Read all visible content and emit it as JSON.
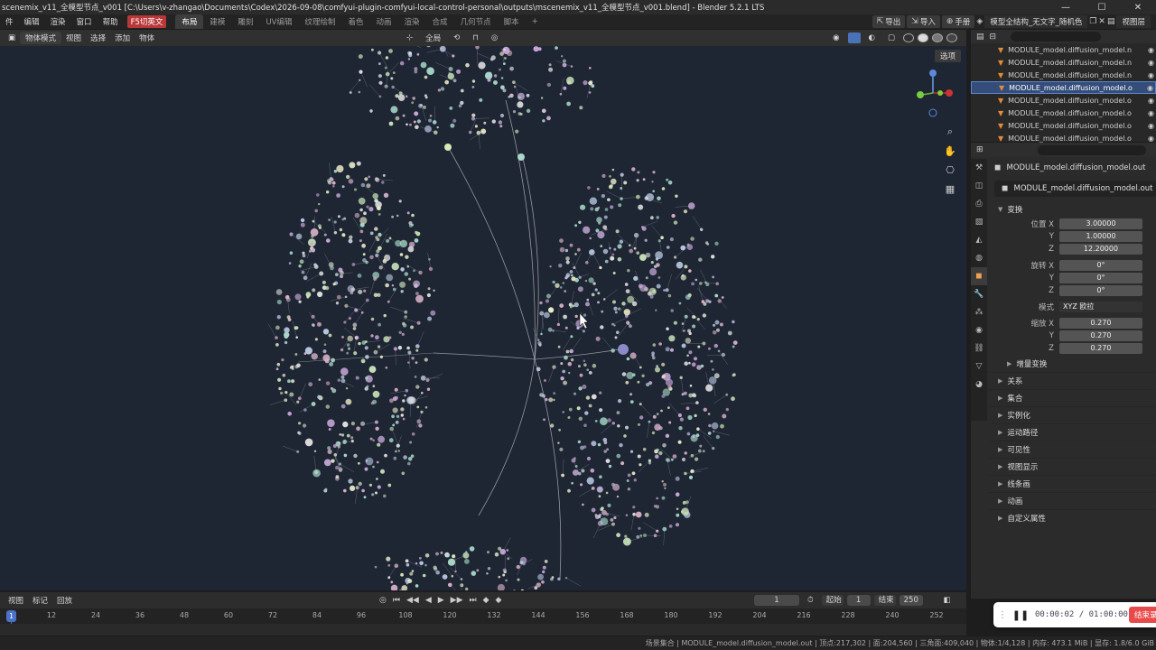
{
  "window": {
    "title": "scenemix_v11_全模型节点_v001 [C:\\Users\\v-zhangao\\Documents\\Codex\\2026-09-08\\comfyui-plugin-comfyui-local-control-personal\\outputs\\mscenemix_v11_全模型节点_v001.blend] - Blender 5.2.1 LTS",
    "minimize": "—",
    "maximize": "☐",
    "close": "✕"
  },
  "menu": [
    "件",
    "编辑",
    "渲染",
    "窗口",
    "帮助"
  ],
  "menu_highlight": "F5切英文",
  "workspace_tabs": [
    {
      "label": "布局",
      "active": true
    },
    {
      "label": "建模",
      "active": false
    },
    {
      "label": "雕刻",
      "active": false
    },
    {
      "label": "UV编辑",
      "active": false
    },
    {
      "label": "纹理绘制",
      "active": false
    },
    {
      "label": "着色",
      "active": false
    },
    {
      "label": "动画",
      "active": false
    },
    {
      "label": "渲染",
      "active": false
    },
    {
      "label": "合成",
      "active": false
    },
    {
      "label": "几何节点",
      "active": false
    },
    {
      "label": "脚本",
      "active": false
    },
    {
      "label": "+",
      "active": false
    }
  ],
  "top_right": {
    "export_label": "导出",
    "import_label": "导入",
    "manual_label": "手册",
    "scene_label": "模型全结构_无文字_随机色",
    "viewlayer_label": "视图层"
  },
  "viewport_header": {
    "mode": "物体模式",
    "menus": [
      "视图",
      "选择",
      "添加",
      "物体"
    ],
    "orientation": "全局",
    "options_label": "选项"
  },
  "outliner": {
    "search_placeholder": "",
    "rows": [
      {
        "label": "MODULE_model.diffusion_model.n",
        "selected": false
      },
      {
        "label": "MODULE_model.diffusion_model.n",
        "selected": false
      },
      {
        "label": "MODULE_model.diffusion_model.n",
        "selected": false
      },
      {
        "label": "MODULE_model.diffusion_model.o",
        "selected": true
      },
      {
        "label": "MODULE_model.diffusion_model.o",
        "selected": false
      },
      {
        "label": "MODULE_model.diffusion_model.o",
        "selected": false
      },
      {
        "label": "MODULE_model.diffusion_model.o",
        "selected": false
      },
      {
        "label": "MODULE_model.diffusion_model.o",
        "selected": false
      }
    ]
  },
  "properties": {
    "object_name": "MODULE_model.diffusion_model.out",
    "object_field": "MODULE_model.diffusion_model.out",
    "transform_label": "变换",
    "location": {
      "label": "位置",
      "x": "3.00000",
      "y": "1.00000",
      "z": "12.20000"
    },
    "rotation": {
      "label": "旋转",
      "x": "0°",
      "y": "0°",
      "z": "0°"
    },
    "mode_label": "模式",
    "mode_value": "XYZ 欧拉",
    "scale": {
      "label": "缩放",
      "x": "0.270",
      "y": "0.270",
      "z": "0.270"
    },
    "delta_label": "增量变换",
    "axis_x": "X",
    "axis_y": "Y",
    "axis_z": "Z",
    "sections": [
      "关系",
      "集合",
      "实例化",
      "运动路径",
      "可见性",
      "视图显示",
      "线条画",
      "动画",
      "自定义属性"
    ]
  },
  "timeline": {
    "menus": [
      "视图",
      "标记",
      "回放"
    ],
    "current_frame": "1",
    "start_label": "起始",
    "start_value": "1",
    "end_label": "结束",
    "end_value": "250",
    "ticks": [
      "12",
      "24",
      "36",
      "48",
      "60",
      "72",
      "84",
      "96",
      "108",
      "120",
      "132",
      "144",
      "156",
      "168",
      "180",
      "192",
      "204",
      "216",
      "228",
      "240",
      "252"
    ],
    "cursor_frame": "1"
  },
  "status": {
    "text": "场景集合 | MODULE_model.diffusion_model.out | 顶点:217,302 | 面:204,560 | 三角面:409,040 | 物体:1/4,128 | 内存: 473.1 MiB | 显存: 1.8/6.0 GiB"
  },
  "recorder": {
    "time": "00:00:02 / 01:00:00",
    "stop_label": "结束录制"
  },
  "colors": {
    "viewport_bg": "#1e2533",
    "accent": "#4a72b8",
    "record_stop": "#e84a4a",
    "highlight_menu": "#b8383a"
  }
}
